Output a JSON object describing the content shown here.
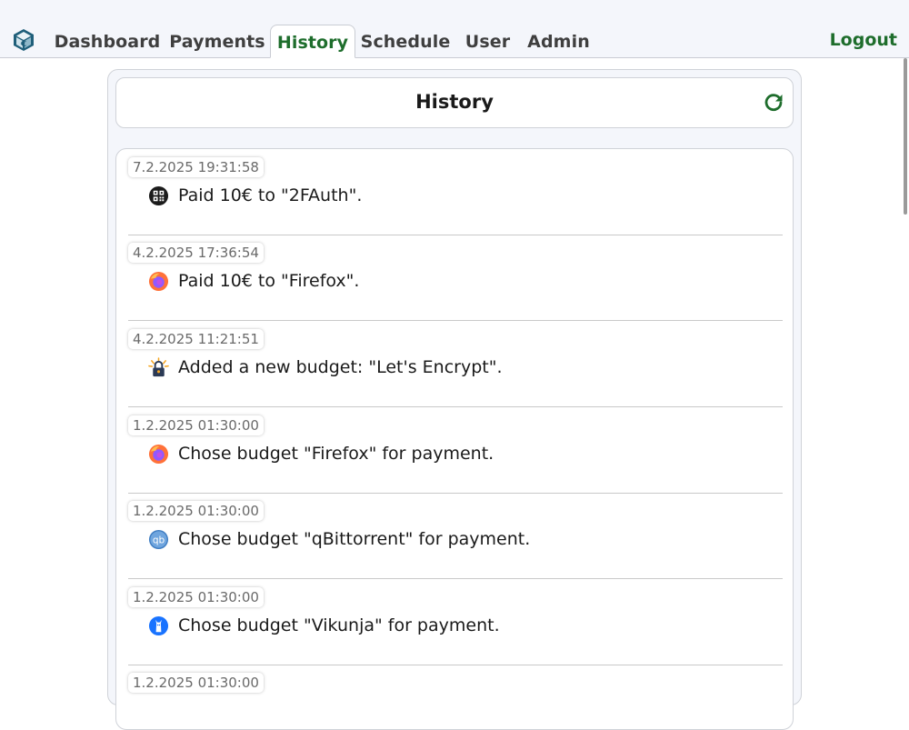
{
  "nav": {
    "logo": "box-logo-icon",
    "tabs": [
      {
        "label": "Dashboard",
        "active": false
      },
      {
        "label": "Payments",
        "active": false
      },
      {
        "label": "History",
        "active": true
      },
      {
        "label": "Schedule",
        "active": false
      },
      {
        "label": "User",
        "active": false
      },
      {
        "label": "Admin",
        "active": false
      }
    ],
    "logout_label": "Logout"
  },
  "header": {
    "title": "History",
    "refresh_icon": "refresh-icon"
  },
  "colors": {
    "accent": "#1e6d2c",
    "nav_bg": "#f4f6fb",
    "text": "#1a1a1a"
  },
  "entries": [
    {
      "timestamp": "7.2.2025 19:31:58",
      "icon": "2fauth-icon",
      "message": "Paid 10€ to \"2FAuth\"."
    },
    {
      "timestamp": "4.2.2025 17:36:54",
      "icon": "firefox-icon",
      "message": "Paid 10€ to \"Firefox\"."
    },
    {
      "timestamp": "4.2.2025 11:21:51",
      "icon": "letsencrypt-icon",
      "message": "Added a new budget: \"Let's Encrypt\"."
    },
    {
      "timestamp": "1.2.2025 01:30:00",
      "icon": "firefox-icon",
      "message": "Chose budget \"Firefox\" for payment."
    },
    {
      "timestamp": "1.2.2025 01:30:00",
      "icon": "qbittorrent-icon",
      "message": "Chose budget \"qBittorrent\" for payment."
    },
    {
      "timestamp": "1.2.2025 01:30:00",
      "icon": "vikunja-icon",
      "message": "Chose budget \"Vikunja\" for payment."
    },
    {
      "timestamp": "1.2.2025 01:30:00",
      "icon": "",
      "message": ""
    }
  ]
}
